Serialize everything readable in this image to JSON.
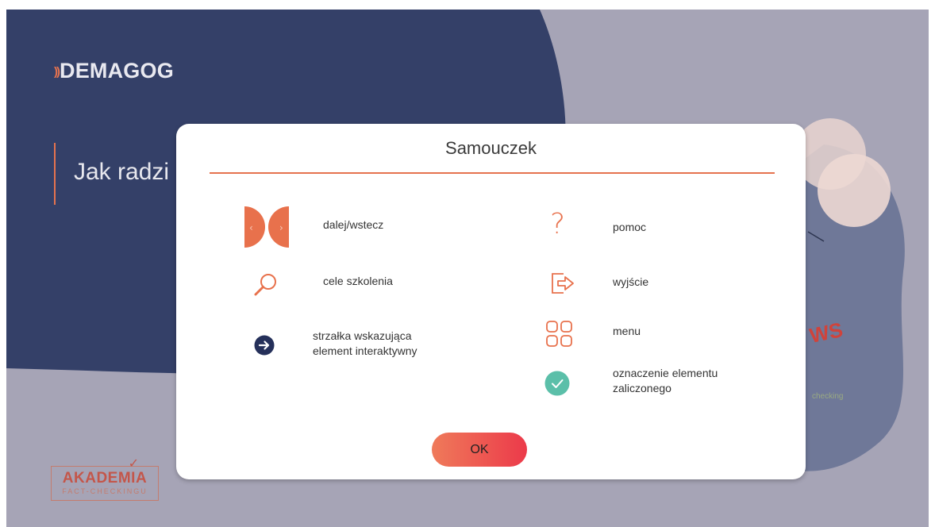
{
  "background": {
    "logo_text": "DEMAGOG",
    "logo_waves": "))",
    "page_title": "Jak radzi",
    "academy_line1": "AKADEMIA",
    "academy_line2": "FACT-CHECKINGU",
    "news_fragment": "WS",
    "news_subtext": "checking"
  },
  "modal": {
    "title": "Samouczek",
    "items": [
      {
        "icon": "next-prev-icon",
        "label": "dalej/wstecz"
      },
      {
        "icon": "question-icon",
        "label": "pomoc"
      },
      {
        "icon": "search-icon",
        "label": "cele szkolenia"
      },
      {
        "icon": "exit-icon",
        "label": "wyjście"
      },
      {
        "icon": "arrow-right-circle-icon",
        "label_line1": "strzałka wskazująca",
        "label_line2": "element interaktywny"
      },
      {
        "icon": "grid-menu-icon",
        "label": "menu"
      },
      {
        "icon": "check-circle-icon",
        "label_line1": "oznaczenie elementu",
        "label_line2": "zaliczonego"
      }
    ],
    "ok_label": "OK",
    "prev_glyph": "‹",
    "next_glyph": "›",
    "question_glyph": "?"
  },
  "colors": {
    "accent": "#e5734f",
    "navy": "#344068",
    "check": "#5bbfa9",
    "backdrop": "#a6a4b6"
  }
}
